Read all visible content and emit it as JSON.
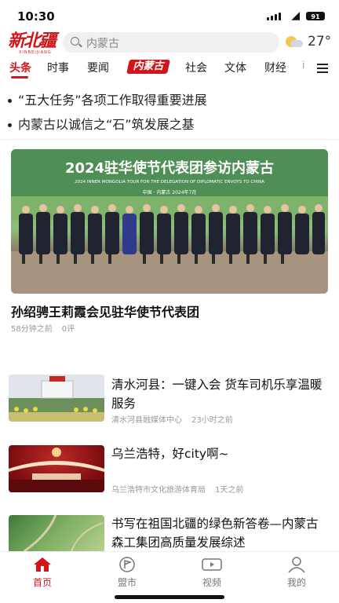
{
  "status_bar": {
    "time": "10:30",
    "battery": "91"
  },
  "header": {
    "logo_text": "新北疆",
    "logo_sub": "XINBEIJIANG",
    "search_placeholder": "内蒙古",
    "temperature": "27°"
  },
  "tabs": [
    {
      "label": "头条",
      "active": true
    },
    {
      "label": "时事"
    },
    {
      "label": "要闻"
    },
    {
      "label": "内蒙古"
    },
    {
      "label": "社会"
    },
    {
      "label": "文体"
    },
    {
      "label": "财经"
    },
    {
      "label": "i"
    }
  ],
  "headlines": [
    "“五大任务”各项工作取得重要进展",
    "内蒙古以诚信之“石”筑发展之基"
  ],
  "featured": {
    "banner_title": "2024驻华使节代表团参访内蒙古",
    "banner_subtitle": "2024 INNER MONGOLIA TOUR FOR THE DELEGATION OF DIPLOMATIC ENVOYS TO CHINA",
    "banner_caption": "中国 · 内蒙古    2024年7月",
    "title": "孙绍骋王莉霞会见驻华使节代表团",
    "time": "58分钟之前",
    "comments": "0评"
  },
  "articles": [
    {
      "title": "清水河县：一键入会 货车司机乐享温暖服务",
      "source": "清水河县融媒体中心",
      "time": "23小时之前",
      "thumb_colors": [
        "#dfe5ea",
        "#6d8f5c",
        "#c8c070"
      ]
    },
    {
      "title": "乌兰浩特，好city啊~",
      "source": "乌兰浩特市文化旅游体育局",
      "time": "1天之前",
      "thumb_colors": [
        "#7a0d10",
        "#c12a24",
        "#e6c9a8"
      ]
    },
    {
      "title": "书写在祖国北疆的绿色新答卷—内蒙古森工集团高质量发展综述",
      "source": "",
      "time": "",
      "thumb_colors": [
        "#3f7a3a",
        "#7fb063",
        "#b8cf8e"
      ]
    }
  ],
  "bottom_nav": [
    {
      "label": "首页",
      "icon": "home-icon",
      "active": true
    },
    {
      "label": "盟市",
      "icon": "flag-icon"
    },
    {
      "label": "视频",
      "icon": "video-icon"
    },
    {
      "label": "我的",
      "icon": "user-icon"
    }
  ],
  "colors": {
    "accent": "#d0161b",
    "text": "#222222",
    "meta": "#999999"
  }
}
